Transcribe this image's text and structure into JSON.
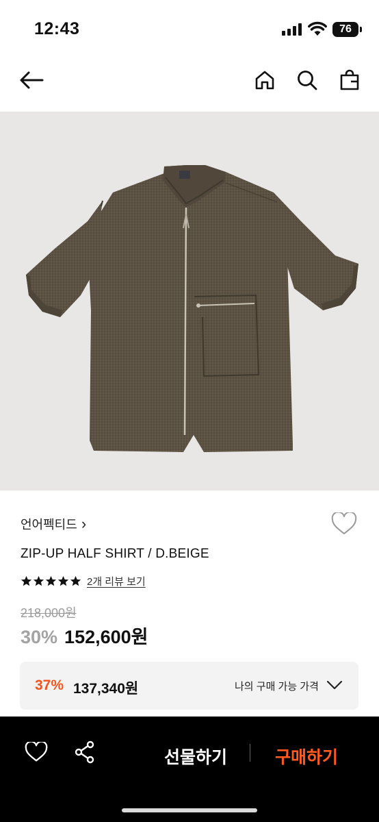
{
  "status": {
    "time": "12:43",
    "battery": "76"
  },
  "nav": {
    "back_icon": "arrow-left-icon",
    "home_icon": "home-icon",
    "search_icon": "search-icon",
    "bag_icon": "shopping-bag-icon"
  },
  "product": {
    "brand": "언어펙티드",
    "brand_chevron": "›",
    "title": "ZIP-UP HALF SHIRT / D.BEIGE",
    "rating_stars": 5,
    "review_link": "2개 리뷰 보기",
    "original_price": "218,000원",
    "discount": "30%",
    "price": "152,600원"
  },
  "my_price": {
    "discount": "37%",
    "price": "137,340원",
    "label": "나의 구매 가능 가격"
  },
  "bottom_bar": {
    "wishlist_icon": "heart-icon",
    "share_icon": "share-icon",
    "gift_label": "선물하기",
    "buy_label": "구매하기"
  },
  "colors": {
    "accent": "#f2551f",
    "buy": "#ff5a1f",
    "image_bg": "#e8e7e5",
    "shirt": "#5b5244"
  }
}
